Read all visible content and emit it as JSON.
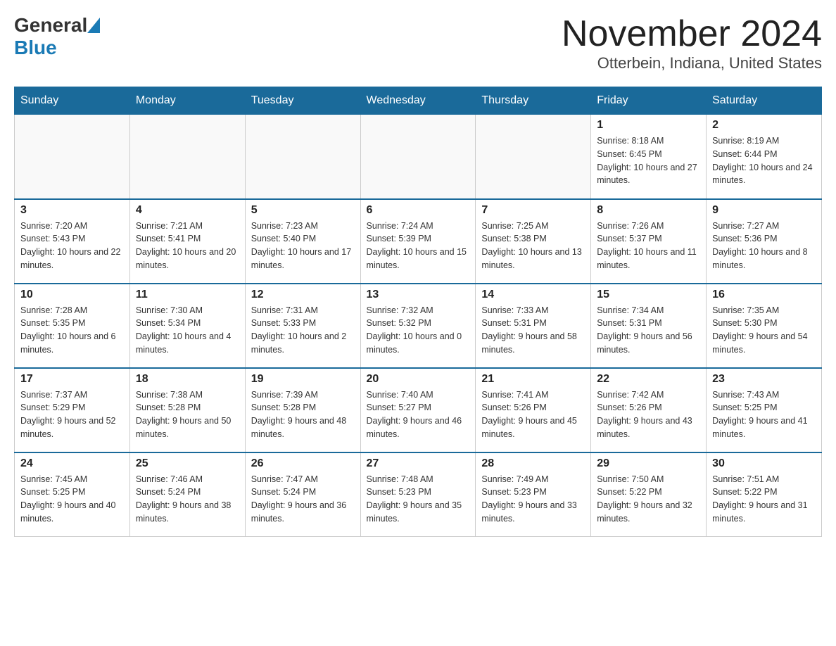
{
  "header": {
    "logo_general": "General",
    "logo_blue": "Blue",
    "title": "November 2024",
    "subtitle": "Otterbein, Indiana, United States"
  },
  "calendar": {
    "days_of_week": [
      "Sunday",
      "Monday",
      "Tuesday",
      "Wednesday",
      "Thursday",
      "Friday",
      "Saturday"
    ],
    "weeks": [
      {
        "days": [
          {
            "number": "",
            "info": ""
          },
          {
            "number": "",
            "info": ""
          },
          {
            "number": "",
            "info": ""
          },
          {
            "number": "",
            "info": ""
          },
          {
            "number": "",
            "info": ""
          },
          {
            "number": "1",
            "info": "Sunrise: 8:18 AM\nSunset: 6:45 PM\nDaylight: 10 hours and 27 minutes."
          },
          {
            "number": "2",
            "info": "Sunrise: 8:19 AM\nSunset: 6:44 PM\nDaylight: 10 hours and 24 minutes."
          }
        ]
      },
      {
        "days": [
          {
            "number": "3",
            "info": "Sunrise: 7:20 AM\nSunset: 5:43 PM\nDaylight: 10 hours and 22 minutes."
          },
          {
            "number": "4",
            "info": "Sunrise: 7:21 AM\nSunset: 5:41 PM\nDaylight: 10 hours and 20 minutes."
          },
          {
            "number": "5",
            "info": "Sunrise: 7:23 AM\nSunset: 5:40 PM\nDaylight: 10 hours and 17 minutes."
          },
          {
            "number": "6",
            "info": "Sunrise: 7:24 AM\nSunset: 5:39 PM\nDaylight: 10 hours and 15 minutes."
          },
          {
            "number": "7",
            "info": "Sunrise: 7:25 AM\nSunset: 5:38 PM\nDaylight: 10 hours and 13 minutes."
          },
          {
            "number": "8",
            "info": "Sunrise: 7:26 AM\nSunset: 5:37 PM\nDaylight: 10 hours and 11 minutes."
          },
          {
            "number": "9",
            "info": "Sunrise: 7:27 AM\nSunset: 5:36 PM\nDaylight: 10 hours and 8 minutes."
          }
        ]
      },
      {
        "days": [
          {
            "number": "10",
            "info": "Sunrise: 7:28 AM\nSunset: 5:35 PM\nDaylight: 10 hours and 6 minutes."
          },
          {
            "number": "11",
            "info": "Sunrise: 7:30 AM\nSunset: 5:34 PM\nDaylight: 10 hours and 4 minutes."
          },
          {
            "number": "12",
            "info": "Sunrise: 7:31 AM\nSunset: 5:33 PM\nDaylight: 10 hours and 2 minutes."
          },
          {
            "number": "13",
            "info": "Sunrise: 7:32 AM\nSunset: 5:32 PM\nDaylight: 10 hours and 0 minutes."
          },
          {
            "number": "14",
            "info": "Sunrise: 7:33 AM\nSunset: 5:31 PM\nDaylight: 9 hours and 58 minutes."
          },
          {
            "number": "15",
            "info": "Sunrise: 7:34 AM\nSunset: 5:31 PM\nDaylight: 9 hours and 56 minutes."
          },
          {
            "number": "16",
            "info": "Sunrise: 7:35 AM\nSunset: 5:30 PM\nDaylight: 9 hours and 54 minutes."
          }
        ]
      },
      {
        "days": [
          {
            "number": "17",
            "info": "Sunrise: 7:37 AM\nSunset: 5:29 PM\nDaylight: 9 hours and 52 minutes."
          },
          {
            "number": "18",
            "info": "Sunrise: 7:38 AM\nSunset: 5:28 PM\nDaylight: 9 hours and 50 minutes."
          },
          {
            "number": "19",
            "info": "Sunrise: 7:39 AM\nSunset: 5:28 PM\nDaylight: 9 hours and 48 minutes."
          },
          {
            "number": "20",
            "info": "Sunrise: 7:40 AM\nSunset: 5:27 PM\nDaylight: 9 hours and 46 minutes."
          },
          {
            "number": "21",
            "info": "Sunrise: 7:41 AM\nSunset: 5:26 PM\nDaylight: 9 hours and 45 minutes."
          },
          {
            "number": "22",
            "info": "Sunrise: 7:42 AM\nSunset: 5:26 PM\nDaylight: 9 hours and 43 minutes."
          },
          {
            "number": "23",
            "info": "Sunrise: 7:43 AM\nSunset: 5:25 PM\nDaylight: 9 hours and 41 minutes."
          }
        ]
      },
      {
        "days": [
          {
            "number": "24",
            "info": "Sunrise: 7:45 AM\nSunset: 5:25 PM\nDaylight: 9 hours and 40 minutes."
          },
          {
            "number": "25",
            "info": "Sunrise: 7:46 AM\nSunset: 5:24 PM\nDaylight: 9 hours and 38 minutes."
          },
          {
            "number": "26",
            "info": "Sunrise: 7:47 AM\nSunset: 5:24 PM\nDaylight: 9 hours and 36 minutes."
          },
          {
            "number": "27",
            "info": "Sunrise: 7:48 AM\nSunset: 5:23 PM\nDaylight: 9 hours and 35 minutes."
          },
          {
            "number": "28",
            "info": "Sunrise: 7:49 AM\nSunset: 5:23 PM\nDaylight: 9 hours and 33 minutes."
          },
          {
            "number": "29",
            "info": "Sunrise: 7:50 AM\nSunset: 5:22 PM\nDaylight: 9 hours and 32 minutes."
          },
          {
            "number": "30",
            "info": "Sunrise: 7:51 AM\nSunset: 5:22 PM\nDaylight: 9 hours and 31 minutes."
          }
        ]
      }
    ]
  }
}
